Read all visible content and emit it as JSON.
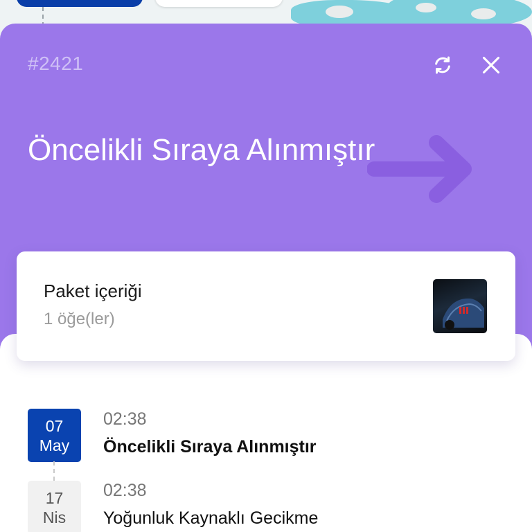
{
  "header": {
    "order_id": "#2421",
    "refresh_icon": "refresh-icon",
    "close_icon": "close-icon",
    "status_title": "Öncelikli Sıraya Alınmıştır",
    "accent_color": "#9b77ea"
  },
  "package": {
    "title": "Paket içeriği",
    "count": "1 öğe(ler)"
  },
  "timeline": [
    {
      "day": "07",
      "month": "May",
      "time": "02:38",
      "text": "Öncelikli Sıraya Alınmıştır",
      "active": true
    },
    {
      "day": "17",
      "month": "Nis",
      "time": "02:38",
      "text": "Yoğunluk Kaynaklı Gecikme",
      "active": false
    }
  ],
  "colors": {
    "active_date": "#0a43b0",
    "inactive_date": "#f1f1f1"
  }
}
